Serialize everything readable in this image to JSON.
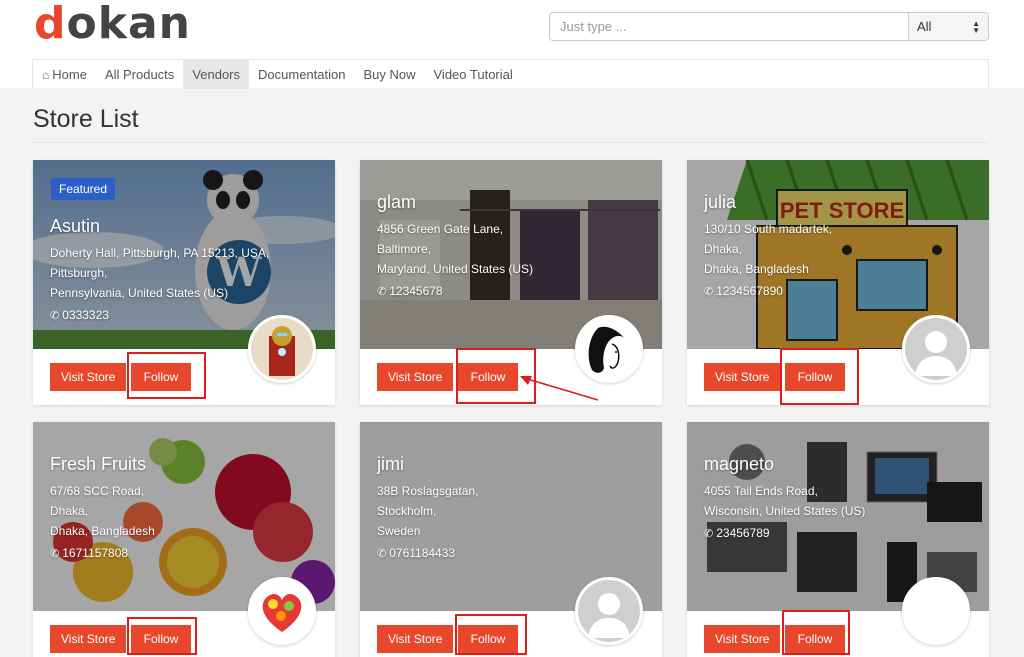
{
  "header": {
    "logo_first": "d",
    "logo_rest": "okan",
    "search_placeholder": "Just type ...",
    "search_category": "All"
  },
  "nav": {
    "items": [
      {
        "label": "Home",
        "icon": "home-icon"
      },
      {
        "label": "All Products"
      },
      {
        "label": "Vendors",
        "active": true
      },
      {
        "label": "Documentation"
      },
      {
        "label": "Buy Now"
      },
      {
        "label": "Video Tutorial"
      }
    ]
  },
  "page": {
    "title": "Store List"
  },
  "stores": [
    {
      "badge": "Featured",
      "name": "Asutin",
      "address": [
        "Doherty Hall, Pittsburgh, PA 15213, USA,",
        "Pittsburgh,",
        "Pennsylvania, United States (US)"
      ],
      "phone": "0333323",
      "visit_label": "Visit Store",
      "follow_label": "Follow"
    },
    {
      "name": "glam",
      "address": [
        "4856 Green Gate Lane,",
        "Baltimore,",
        "Maryland, United States (US)"
      ],
      "phone": "12345678",
      "visit_label": "Visit Store",
      "follow_label": "Follow"
    },
    {
      "name": "julia",
      "address": [
        "130/10 South madartek,",
        "Dhaka,",
        "Dhaka, Bangladesh"
      ],
      "phone": "1234567890",
      "visit_label": "Visit Store",
      "follow_label": "Follow",
      "banner_text": "PET STORE"
    },
    {
      "name": "Fresh Fruits",
      "address": [
        "67/68 SCC Road,",
        "Dhaka,",
        "Dhaka, Bangladesh"
      ],
      "phone": "1671157808",
      "visit_label": "Visit Store",
      "follow_label": "Follow"
    },
    {
      "name": "jimi",
      "address": [
        "38B Roslagsgatan,",
        "Stockholm,",
        "Sweden"
      ],
      "phone": "0761184433",
      "visit_label": "Visit Store",
      "follow_label": "Follow"
    },
    {
      "name": "magneto",
      "address": [
        "4055 Tail Ends Road,",
        "Wisconsin, United States (US)"
      ],
      "phone": "23456789",
      "visit_label": "Visit Store",
      "follow_label": "Follow"
    }
  ],
  "colors": {
    "accent": "#e7472b",
    "badge": "#2d5ec9",
    "annotation": "#e01d1d"
  }
}
